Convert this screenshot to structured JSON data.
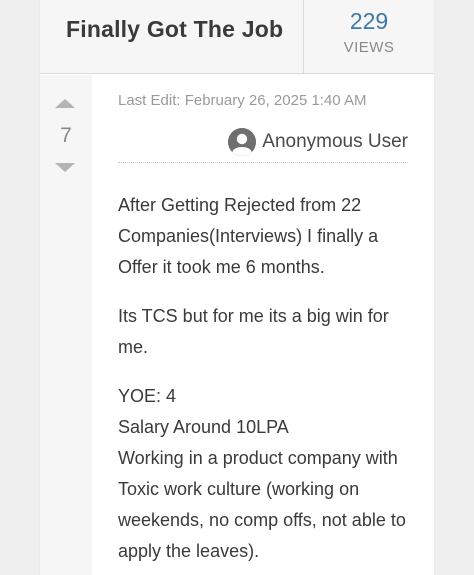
{
  "post": {
    "title": "Finally Got The Job",
    "views": {
      "count": "229",
      "label": "VIEWS"
    },
    "votes": "7",
    "last_edit": "Last Edit: February 26, 2025 1:40 AM",
    "author": "Anonymous User",
    "paragraphs": [
      "After Getting Rejected from 22 Companies(Interviews) I finally a Offer it took me 6 months.",
      "Its TCS but for me its a big win for me."
    ],
    "details": [
      "YOE: 4",
      "Salary Around 10LPA",
      "Working in a product company with Toxic work culture (working on weekends, no comp offs, not able to apply the leaves)."
    ]
  },
  "icons": {
    "upvote": "triangle-up-icon",
    "downvote": "triangle-down-icon",
    "avatar": "user-avatar-icon"
  },
  "colors": {
    "views_count": "#3d78a8",
    "text": "#3a3a3a",
    "muted": "#9a9a9a"
  }
}
